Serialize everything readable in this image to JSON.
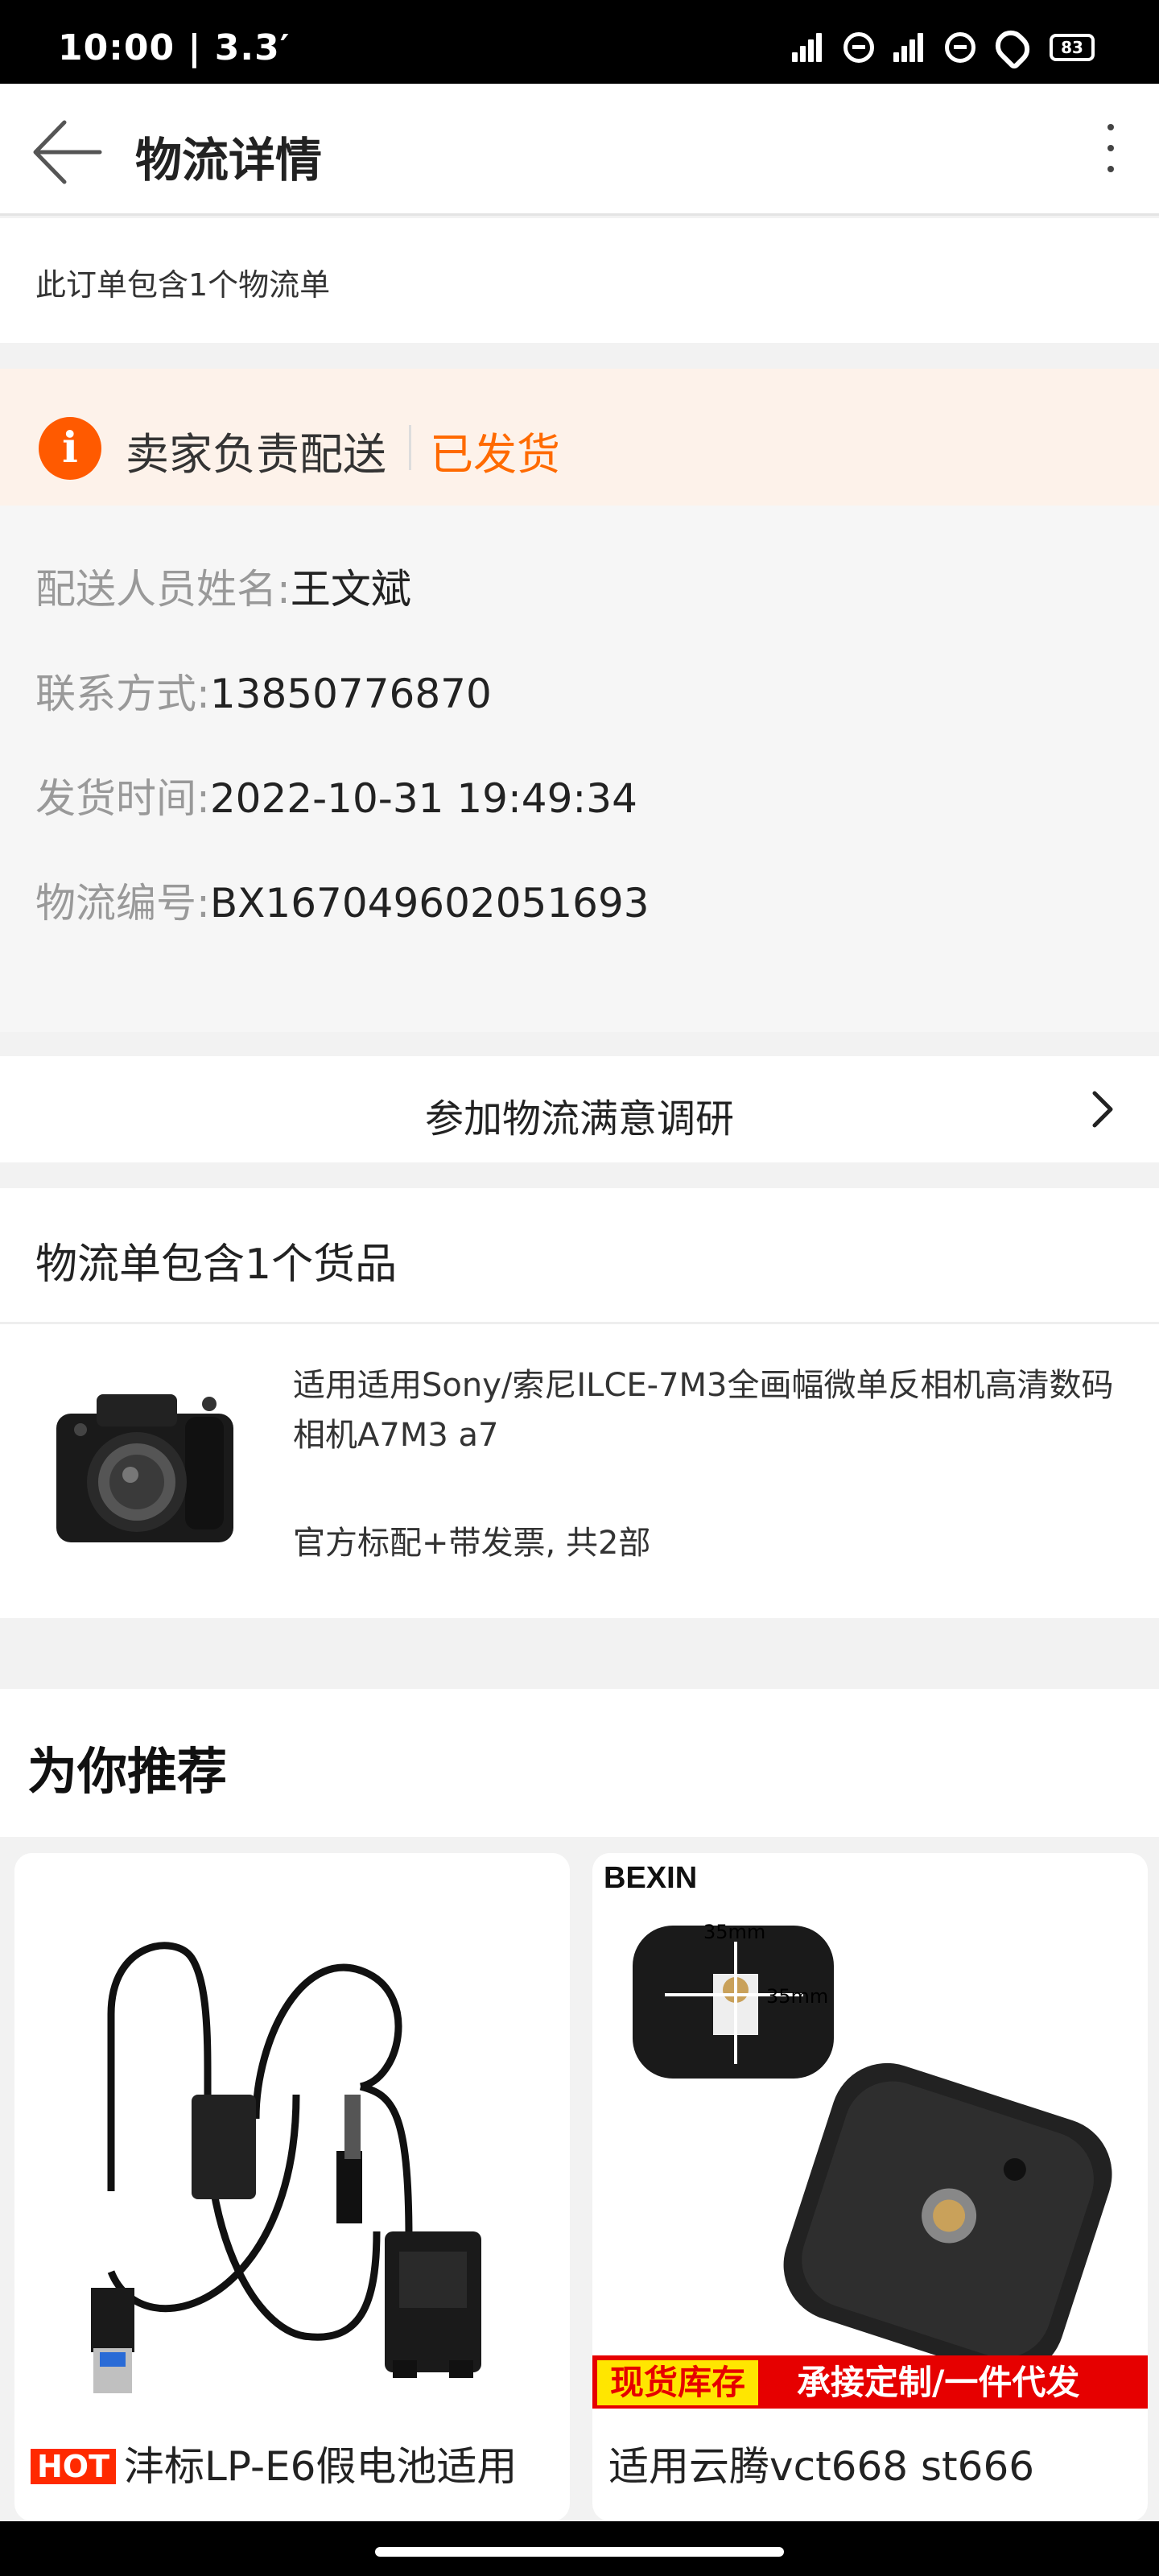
{
  "status_bar": {
    "time": "10:00 | 3.3′",
    "battery": "83"
  },
  "header": {
    "title": "物流详情"
  },
  "order_note": "此订单包含1个物流单",
  "delivery": {
    "type": "卖家负责配送",
    "status": "已发货",
    "status_color": "#ff6a00",
    "rows": [
      {
        "label": "配送人员姓名:",
        "value": "王文斌"
      },
      {
        "label": "联系方式:",
        "value": "13850776870"
      },
      {
        "label": "发货时间:",
        "value": "2022-10-31 19:49:34"
      },
      {
        "label": "物流编号:",
        "value": "BX167049602051693"
      }
    ]
  },
  "survey": {
    "label": "参加物流满意调研"
  },
  "goods": {
    "title": "物流单包含1个货品",
    "product_name": "适用适用Sony/索尼ILCE-7M3全画幅微单反相机高清数码相机A7M3 a7",
    "product_spec": "官方标配+带发票, 共2部"
  },
  "recommend": {
    "title": "为你推荐",
    "items": [
      {
        "badge": "HOT",
        "name": "沣标LP-E6假电池适用"
      },
      {
        "brand": "BEXIN",
        "dim_top": "35mm",
        "dim_right": "35mm",
        "tag_stock": "现货库存",
        "tag_custom": "承接定制/一件代发",
        "name": "适用云腾vct668 st666"
      }
    ]
  }
}
